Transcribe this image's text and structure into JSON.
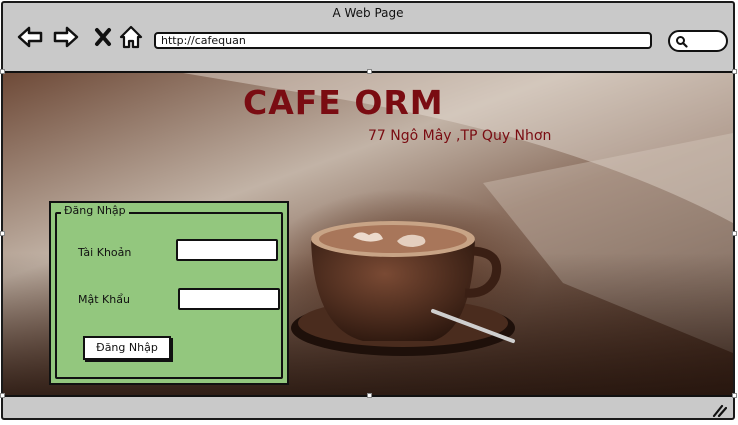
{
  "window": {
    "title": "A Web Page"
  },
  "toolbar": {
    "icons": [
      "back-icon",
      "forward-icon",
      "close-icon",
      "home-icon"
    ],
    "url": "http://cafequan",
    "search_icon": "search-icon"
  },
  "page": {
    "brand": "CAFE ORM",
    "address": "77 Ngô Mây ,TP Quy Nhơn",
    "login": {
      "legend": "Đăng Nhập",
      "username_label": "Tài Khoản",
      "username_value": "",
      "password_label": "Mật Khẩu",
      "password_value": "",
      "submit_label": "Đăng Nhập"
    }
  },
  "colors": {
    "brand_red": "#7a0c12",
    "login_panel": "#93c77e",
    "browser_chrome": "#c9c9c9"
  },
  "status_bar": {
    "resize_icon": "resize-grip-icon"
  }
}
